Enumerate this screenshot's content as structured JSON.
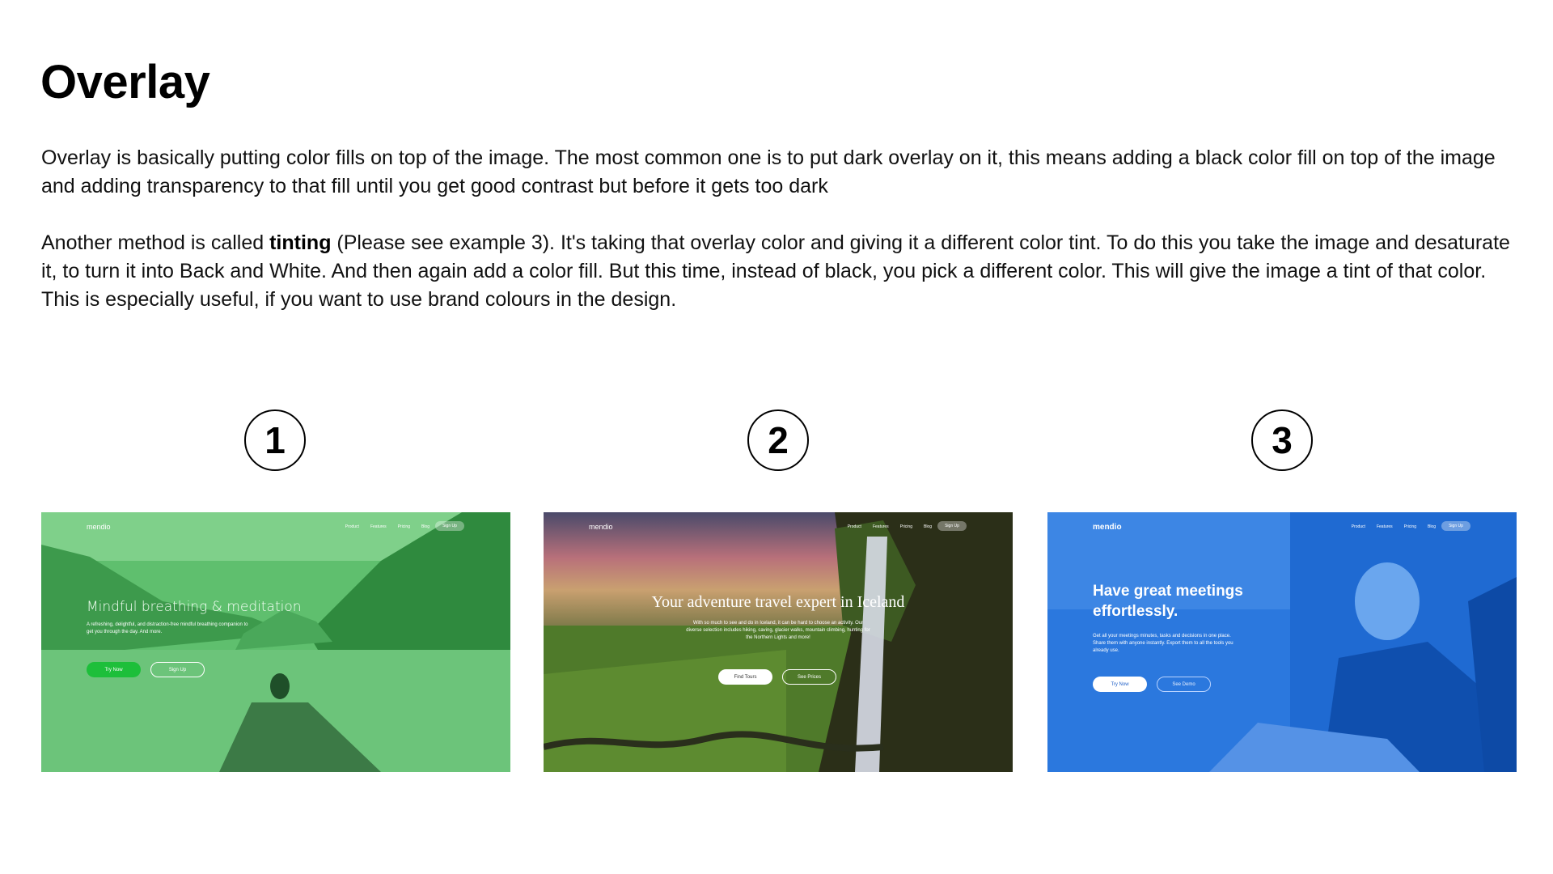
{
  "title": "Overlay",
  "paragraph1": "Overlay is basically putting color fills on top of the image. The most common one is to put dark  overlay on it, this means adding a black color fill on top of the image and adding transparency to that fill until you get good contrast but before it gets too dark",
  "paragraph2": {
    "pre": "Another method is called ",
    "bold": "tinting",
    "post": " (Please see example 3). It's taking that overlay color and giving it a different color tint. To do this you take the image and desaturate it, to turn it into Back and White. And then again add a color fill. But this time, instead of black, you pick a different color. This will give the image a tint of that color.  This is especially useful, if you want to use brand colours in the design."
  },
  "examples": [
    {
      "number": "1",
      "logo": "mendio",
      "nav": [
        "Product",
        "Features",
        "Pricing",
        "Blog"
      ],
      "signup": "Sign Up",
      "headline": "Mindful breathing & meditation",
      "sub": "A refreshing, delightful, and distraction-free mindful breathing companion to get you through the day. And more.",
      "primary": "Try Now",
      "secondary": "Sign Up",
      "tint": "#2f9a4a"
    },
    {
      "number": "2",
      "logo": "mendio",
      "nav": [
        "Product",
        "Features",
        "Pricing",
        "Blog"
      ],
      "signup": "Sign Up",
      "headline": "Your adventure travel expert in Iceland",
      "sub": "With so much to see and do in Iceland, it can be hard to choose an activity. Our diverse selection includes hiking, caving, glacier walks, mountain climbing, hunting for the Northern Lights and more!",
      "primary": "Find Tours",
      "secondary": "See Prices",
      "tint": "#2a3a22"
    },
    {
      "number": "3",
      "logo": "mendio",
      "nav": [
        "Product",
        "Features",
        "Pricing",
        "Blog"
      ],
      "signup": "Sign Up",
      "headline": "Have great meetings effortlessly.",
      "sub": "Get all your meetings minutes, tasks and decisions in one place. Share them with anyone instantly. Export them to all the tools you already use.",
      "primary": "Try Now",
      "secondary": "See Demo",
      "tint": "#1e6fd6"
    }
  ]
}
